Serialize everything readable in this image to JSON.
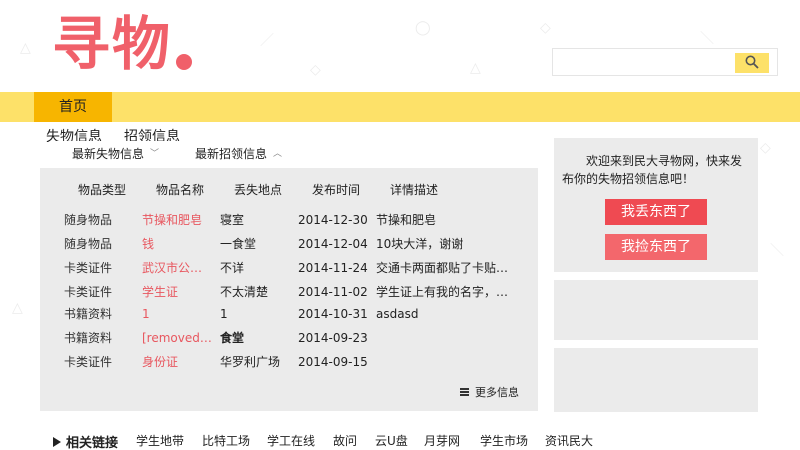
{
  "logo": {
    "text": "寻物"
  },
  "search": {
    "placeholder": "",
    "value": ""
  },
  "nav": {
    "home": "首页"
  },
  "sub_tabs": [
    "失物信息",
    "招领信息"
  ],
  "tabs": [
    {
      "label": "最新失物信息",
      "chevron": "﹀"
    },
    {
      "label": "最新招领信息",
      "chevron": "︿"
    }
  ],
  "columns": [
    "物品类型",
    "物品名称",
    "丢失地点",
    "发布时间",
    "详情描述"
  ],
  "rows": [
    {
      "type": "随身物品",
      "name": "节操和肥皂",
      "location": "寝室",
      "date": "2014-12-30",
      "desc": "节操和肥皂",
      "bold_loc": false
    },
    {
      "type": "随身物品",
      "name": "钱",
      "location": "一食堂",
      "date": "2014-12-04",
      "desc": "10块大洋，谢谢",
      "bold_loc": false
    },
    {
      "type": "卡类证件",
      "name": "武汉市公交...",
      "location": "不详",
      "date": "2014-11-24",
      "desc": "交通卡两面都贴了卡贴，一...",
      "bold_loc": false
    },
    {
      "type": "卡类证件",
      "name": "学生证",
      "location": "不太清楚",
      "date": "2014-11-02",
      "desc": "学生证上有我的名字，对我...",
      "bold_loc": false
    },
    {
      "type": "书籍资料",
      "name": "1",
      "location": "1",
      "date": "2014-10-31",
      "desc": "asdasd",
      "bold_loc": false
    },
    {
      "type": "书籍资料",
      "name": "[removed]a...",
      "location": "食堂",
      "date": "2014-09-23",
      "desc": "",
      "bold_loc": true
    },
    {
      "type": "卡类证件",
      "name": "身份证",
      "location": "华罗利广场",
      "date": "2014-09-15",
      "desc": "",
      "bold_loc": false
    }
  ],
  "more": "更多信息",
  "sidebar": {
    "welcome": "欢迎来到民大寻物网，快来发布你的失物招领信息吧！",
    "lost_button": "我丢东西了",
    "found_button": "我捡东西了"
  },
  "footer": {
    "title": "相关链接",
    "links": [
      "学生地带",
      "比特工场",
      "学工在线",
      "故问",
      "云U盘",
      "月芽网",
      "学生市场",
      "资讯民大"
    ]
  },
  "colors": {
    "accent_yellow": "#fde169",
    "nav_active": "#f7b500",
    "logo_red": "#f0606a",
    "link_red": "#e8575f",
    "btn_lost": "#ef4a52",
    "btn_found": "#f3676c",
    "panel_gray": "#ebebeb"
  },
  "icons": {
    "search": "search-icon",
    "more": "list-icon",
    "footer": "link-icon"
  }
}
